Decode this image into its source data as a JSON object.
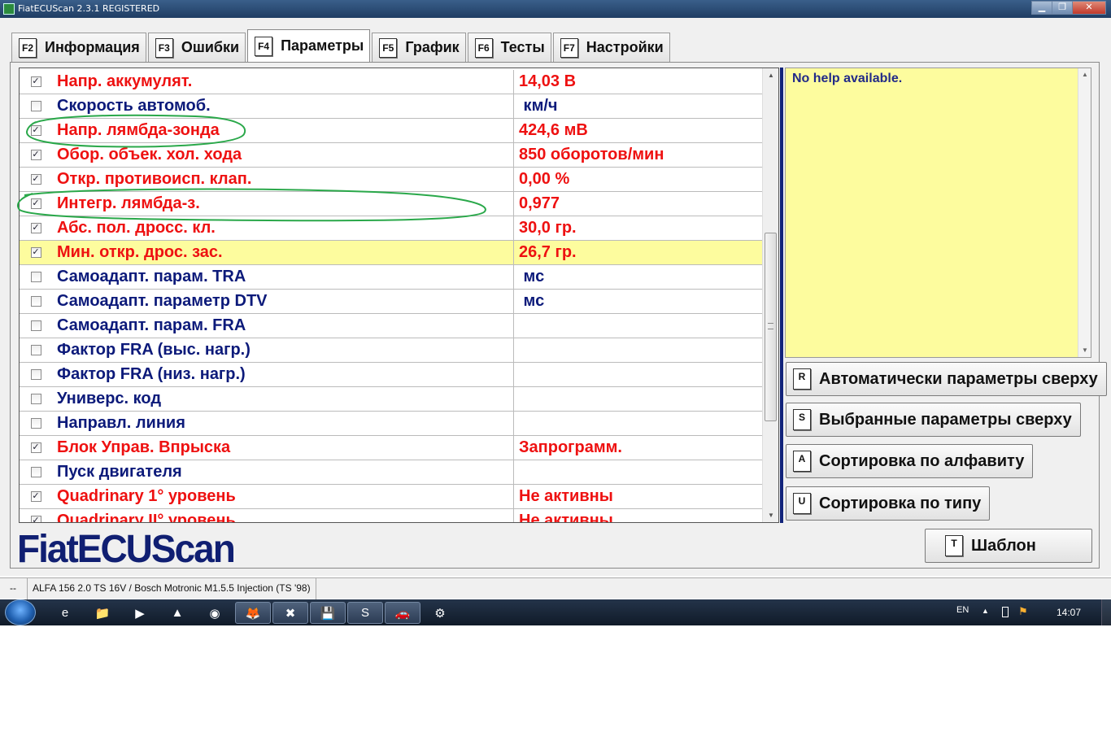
{
  "window": {
    "title": "FiatECUScan 2.3.1 REGISTERED",
    "buttons": [
      "▁",
      "❐",
      "✕"
    ]
  },
  "tabs": [
    {
      "key": "F2",
      "label": "Информация",
      "active": false
    },
    {
      "key": "F3",
      "label": "Ошибки",
      "active": false
    },
    {
      "key": "F4",
      "label": "Параметры",
      "active": true
    },
    {
      "key": "F5",
      "label": "График",
      "active": false
    },
    {
      "key": "F6",
      "label": "Тесты",
      "active": false
    },
    {
      "key": "F7",
      "label": "Настройки",
      "active": false
    }
  ],
  "parameters": [
    {
      "checked": true,
      "name": "Напр. аккумулят.",
      "value": "14,03 В",
      "color": "red"
    },
    {
      "checked": false,
      "name": "Скорость автомоб.",
      "value": " км/ч",
      "color": "blue"
    },
    {
      "checked": true,
      "name": "Напр. лямбда-зонда",
      "value": "424,6 мВ",
      "color": "red"
    },
    {
      "checked": true,
      "name": "Обор. объек. хол. хода",
      "value": "850 оборотов/мин",
      "color": "red"
    },
    {
      "checked": true,
      "name": "Откр. противоисп. клап.",
      "value": "0,00 %",
      "color": "red"
    },
    {
      "checked": true,
      "name": "Интегр. лямбда-з.",
      "value": "0,977",
      "color": "red"
    },
    {
      "checked": true,
      "name": "Абс. пол. дросс. кл.",
      "value": "30,0 гр.",
      "color": "red"
    },
    {
      "checked": true,
      "name": "Мин. откр. дрос. зас.",
      "value": "26,7 гр.",
      "color": "red",
      "highlighted": true
    },
    {
      "checked": false,
      "name": "Самоадапт. парам. TRA",
      "value": " мс",
      "color": "blue"
    },
    {
      "checked": false,
      "name": "Самоадапт. параметр DTV",
      "value": " мс",
      "color": "blue"
    },
    {
      "checked": false,
      "name": "Самоадапт. парам. FRA",
      "value": "",
      "color": "blue"
    },
    {
      "checked": false,
      "name": "Фактор FRA (выс. нагр.)",
      "value": "",
      "color": "blue"
    },
    {
      "checked": false,
      "name": "Фактор FRA (низ. нагр.)",
      "value": "",
      "color": "blue"
    },
    {
      "checked": false,
      "name": "Универс. код",
      "value": "",
      "color": "blue"
    },
    {
      "checked": false,
      "name": "Направл. линия",
      "value": "",
      "color": "blue"
    },
    {
      "checked": true,
      "name": "Блок Управ. Впрыска",
      "value": "Запрограмм.",
      "color": "red"
    },
    {
      "checked": false,
      "name": "Пуск двигателя",
      "value": "",
      "color": "blue"
    },
    {
      "checked": true,
      "name": "Quadrinary 1° уровень",
      "value": "Не активны",
      "color": "red"
    },
    {
      "checked": true,
      "name": "Quadrinary II° уровень",
      "value": "Не активны",
      "color": "red"
    }
  ],
  "help": {
    "text": "No help available."
  },
  "side_buttons": [
    {
      "key": "R",
      "label": "Автоматически параметры сверху"
    },
    {
      "key": "S",
      "label": "Выбранные параметры сверху"
    },
    {
      "key": "A",
      "label": "Сортировка по алфавиту"
    },
    {
      "key": "U",
      "label": "Сортировка по типу"
    },
    {
      "key": "T",
      "label": "Шаблон"
    }
  ],
  "logo": {
    "text": "FiatECUScan"
  },
  "statusbar": {
    "left": "--",
    "vehicle": "ALFA 156 2.0 TS 16V / Bosch Motronic M1.5.5 Injection (TS '98)"
  },
  "taskbar": {
    "items": [
      "e",
      "📁",
      "▶",
      "▲",
      "◉",
      "🦊",
      "✖",
      "💾",
      "S",
      "🚗",
      "⚙"
    ],
    "language": "EN",
    "clock": "14:07"
  },
  "colors": {
    "red_text": "#ee1111",
    "blue_text": "#0c1a7a",
    "highlight": "#fdfc9e",
    "annotation": "#2aa84a"
  }
}
